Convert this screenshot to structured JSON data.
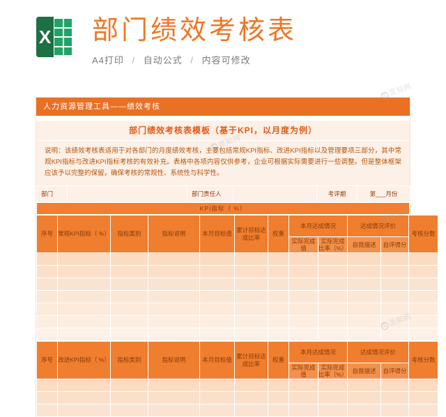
{
  "header": {
    "logo_name": "excel-logo",
    "logo_letter": "X",
    "title": "部门绩效考核表",
    "subtitle_parts": [
      "A4打印",
      "自动公式",
      "内容可修改"
    ],
    "separator": "/"
  },
  "sheet": {
    "orange_bar": "人力资源管理工具——绩效考核",
    "sheet_title": "部门绩效考核表模板（基于KPI，以月度为例）",
    "note": "说明：该绩效考核表适用于对各部门的月度绩效考核，主要包括常规KPI指标、改进KPI指标以及管理要项三部分，其中常规KPI指标与改进KPI指标考核的有效补充。表格中各项内容仅供参考，企业可根据实际需要进行一些调整。但是整体框架应该予以完整的保留，确保考核的常规性、系统性与科学性。",
    "info_row": {
      "dept_label": "部门",
      "dept_value": "",
      "owner_label": "部门责任人",
      "owner_value": "",
      "period_label": "考评期",
      "period_value": "第___月份"
    },
    "kpi_band": "KPI指标（      %）",
    "section1": {
      "headers": [
        "序号",
        "常规KPI指标（      %）",
        "指标类别",
        "指标说明",
        "本月目标值",
        "累计目标达成比率",
        "权重",
        "本月达成情况",
        "达成情况评价",
        "考核分数"
      ],
      "sub_headers_achievement": [
        "实际完成值",
        "实际完成比率（%）"
      ],
      "sub_headers_evaluation": [
        "自我描述",
        "自评得分"
      ],
      "row_count": 7
    },
    "section2": {
      "headers": [
        "序号",
        "改进KPI指标（      %）",
        "指标类别",
        "指标说明",
        "本月目标值",
        "累计目标达成比率",
        "权重",
        "本月达成情况",
        "达成情况评价",
        "考核分数"
      ],
      "sub_headers_achievement": [
        "实际完成值",
        "实际完成比率（%）"
      ],
      "sub_headers_evaluation": [
        "自我描述",
        "自评得分"
      ],
      "row_count": 3
    }
  },
  "watermarks": [
    "觅知网",
    "觅知网",
    "觅知网",
    "觅知网"
  ],
  "colors": {
    "accent_orange": "#ea7024",
    "title_orange": "#f07623",
    "excel_green": "#1d7044",
    "note_bg": "#fdf0e6"
  }
}
